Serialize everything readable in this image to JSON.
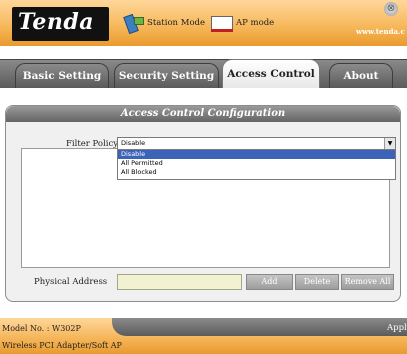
{
  "header": {
    "logo": "Tenda",
    "station_mode": "Station Mode",
    "ap_mode": "AP mode",
    "url": "www.tenda.c",
    "close_symbol": "⊗"
  },
  "tabs": [
    {
      "label": "Basic Setting",
      "active": false
    },
    {
      "label": "Security Setting",
      "active": false
    },
    {
      "label": "Access Control",
      "active": true
    },
    {
      "label": "About",
      "active": false
    }
  ],
  "panel": {
    "title": "Access Control Configuration",
    "filter_label": "Filter Policy",
    "filter_value": "Disable",
    "options": [
      "Disable",
      "All Permitted",
      "All Blocked"
    ],
    "mac_label": "Physical Address",
    "mac_value": "",
    "buttons": {
      "add": "Add",
      "delete": "Delete",
      "remove_all": "Remove All"
    }
  },
  "footer": {
    "model": "Model No. : W302P",
    "adapter": "Wireless PCI Adapter/Soft AP",
    "apply": "Apply"
  },
  "colors": {
    "header_orange": "#f6b657",
    "tab_gray": "#6a6a6a",
    "selection_blue": "#3b63b8"
  },
  "icons": [
    "station-icon",
    "ap-icon",
    "close-icon",
    "dropdown-arrow-icon"
  ]
}
